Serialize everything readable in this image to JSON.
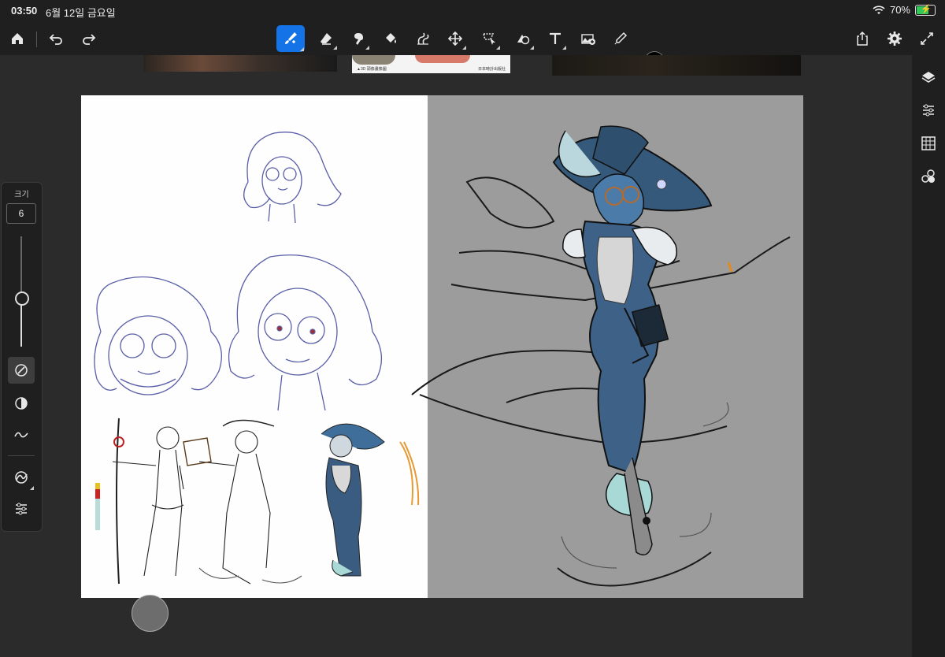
{
  "status": {
    "time": "03:50",
    "date": "6월 12일 금요일",
    "battery_percent": "70%",
    "battery_level": 0.7
  },
  "toolbar": {
    "left": [
      "home-icon",
      "undo-icon",
      "redo-icon"
    ],
    "tools": [
      "brush-icon",
      "eraser-icon",
      "smudge-icon",
      "fill-icon",
      "liquify-icon",
      "move-icon",
      "selection-icon",
      "shape-icon",
      "text-icon",
      "add-image-icon",
      "eyedropper-icon"
    ],
    "active_tool": "brush-icon",
    "current_color": "#000000",
    "right": [
      "share-icon",
      "settings-icon",
      "fullscreen-icon"
    ]
  },
  "brush_panel": {
    "size_label": "크기",
    "size_value": "6",
    "slider_level": 0.45
  },
  "right_panel": [
    "layers-icon",
    "adjustments-icon",
    "grid-icon",
    "shapes-icon"
  ],
  "reference_caption": {
    "left": "▲3D 頭像畫像圖",
    "right": "日本時計出版社"
  }
}
